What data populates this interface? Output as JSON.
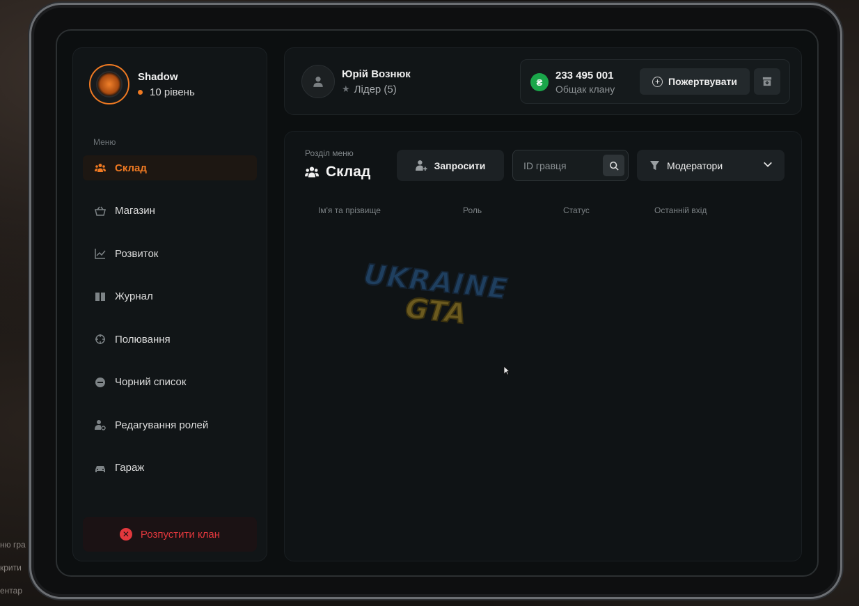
{
  "background": {
    "overlay_lines": [
      "ню гра",
      "крити ",
      "ентар"
    ]
  },
  "clan": {
    "name": "Shadow",
    "level": "10 рівень",
    "accent_color": "#f07a22"
  },
  "sidebar": {
    "menu_caption": "Меню",
    "items": [
      {
        "label": "Склад",
        "icon": "members-icon",
        "active": true
      },
      {
        "label": "Магазин",
        "icon": "basket-icon",
        "active": false
      },
      {
        "label": "Розвиток",
        "icon": "chart-icon",
        "active": false
      },
      {
        "label": "Журнал",
        "icon": "book-icon",
        "active": false
      },
      {
        "label": "Полювання",
        "icon": "crosshair-icon",
        "active": false
      },
      {
        "label": "Чорний список",
        "icon": "blocked-icon",
        "active": false
      },
      {
        "label": "Редагування ролей",
        "icon": "user-gear-icon",
        "active": false
      },
      {
        "label": "Гараж",
        "icon": "car-icon",
        "active": false
      }
    ],
    "dissolve_label": "Розпустити клан"
  },
  "header": {
    "leader_name": "Юрій Вознюк",
    "leader_role": "Лідер (5)",
    "bank_amount": "233 495 001",
    "bank_label": "Общак клану",
    "currency_symbol": "₴",
    "donate_label": "Пожертвувати"
  },
  "main": {
    "section_caption": "Розділ меню",
    "section_title": "Склад",
    "invite_label": "Запросити",
    "search_placeholder": "ID гравця",
    "filter_selected": "Модератори",
    "columns": [
      "Ім'я та прізвище",
      "Роль",
      "Статус",
      "Останній вхід"
    ],
    "watermark_top": "UKRAINE",
    "watermark_bottom": "GTA"
  }
}
